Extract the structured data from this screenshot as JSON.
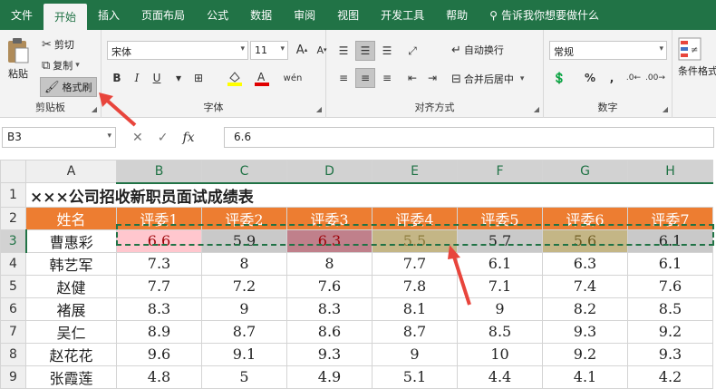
{
  "menu": [
    "文件",
    "开始",
    "插入",
    "页面布局",
    "公式",
    "数据",
    "审阅",
    "视图",
    "开发工具",
    "帮助"
  ],
  "search_text": "告诉我你想要做什么",
  "ribbon": {
    "paste": "粘贴",
    "cut": "剪切",
    "copy": "复制",
    "format_painter": "格式刷",
    "clipboard_label": "剪贴板",
    "font_name": "宋体",
    "font_size": "11",
    "font_label": "字体",
    "bold": "B",
    "italic": "I",
    "underline": "U",
    "wrap_text": "自动换行",
    "merge_center": "合并后居中",
    "alignment_label": "对齐方式",
    "number_format": "常规",
    "percent": "%",
    "comma": ",",
    "number_label": "数字",
    "conditional": "条件格式"
  },
  "formula_bar": {
    "name_box": "B3",
    "fx": "fx",
    "value": "6.6"
  },
  "sheet": {
    "columns": [
      "A",
      "B",
      "C",
      "D",
      "E",
      "F",
      "G",
      "H"
    ],
    "rows": [
      {
        "n": "1",
        "cells": [
          "×××公司招收新职员面试成绩表"
        ]
      },
      {
        "n": "2",
        "cells": [
          "姓名",
          "评委1",
          "评委2",
          "评委3",
          "评委4",
          "评委5",
          "评委6",
          "评委7"
        ]
      },
      {
        "n": "3",
        "cells": [
          "曹惠彩",
          "6.6",
          "5.9",
          "6.3",
          "5.5",
          "5.7",
          "5.6",
          "6.1"
        ]
      },
      {
        "n": "4",
        "cells": [
          "韩艺军",
          "7.3",
          "8",
          "8",
          "7.7",
          "6.1",
          "6.3",
          "6.1"
        ]
      },
      {
        "n": "5",
        "cells": [
          "赵健",
          "7.7",
          "7.2",
          "7.6",
          "7.8",
          "7.1",
          "7.4",
          "7.6"
        ]
      },
      {
        "n": "6",
        "cells": [
          "褚展",
          "8.3",
          "9",
          "8.3",
          "8.1",
          "9",
          "8.2",
          "8.5"
        ]
      },
      {
        "n": "7",
        "cells": [
          "吴仁",
          "8.9",
          "8.7",
          "8.6",
          "8.7",
          "8.5",
          "9.3",
          "9.2"
        ]
      },
      {
        "n": "8",
        "cells": [
          "赵花花",
          "9.6",
          "9.1",
          "9.3",
          "9",
          "10",
          "9.2",
          "9.3"
        ]
      },
      {
        "n": "9",
        "cells": [
          "张霞莲",
          "4.8",
          "5",
          "4.9",
          "5.1",
          "4.4",
          "4.1",
          "4.2"
        ]
      }
    ]
  },
  "colors": {
    "accent": "#217346",
    "header_fill": "#ed7d31",
    "arrow": "#e8453c"
  }
}
